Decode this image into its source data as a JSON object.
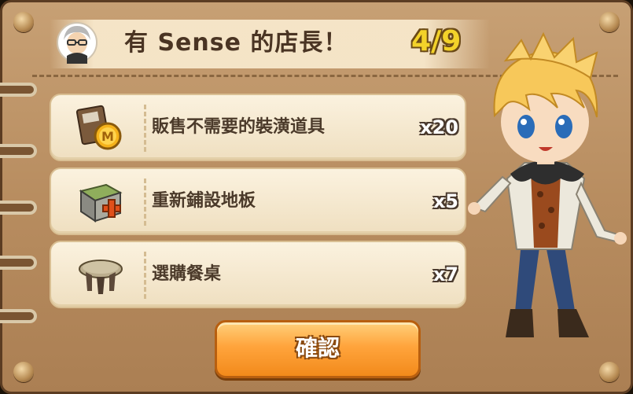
{
  "mission": {
    "title": "有 Sense 的店長！",
    "progress": "4/9"
  },
  "tasks": [
    {
      "label": "販售不需要的裝潢道具",
      "count": "x20",
      "icon": "sell-decoration-icon"
    },
    {
      "label": "重新鋪設地板",
      "count": "x5",
      "icon": "floor-tile-icon"
    },
    {
      "label": "選購餐桌",
      "count": "x7",
      "icon": "table-icon"
    }
  ],
  "confirm_label": "確認",
  "colors": {
    "panel": "#b88d60",
    "progress_text": "#f3d22a",
    "button": "#ffa43c"
  }
}
